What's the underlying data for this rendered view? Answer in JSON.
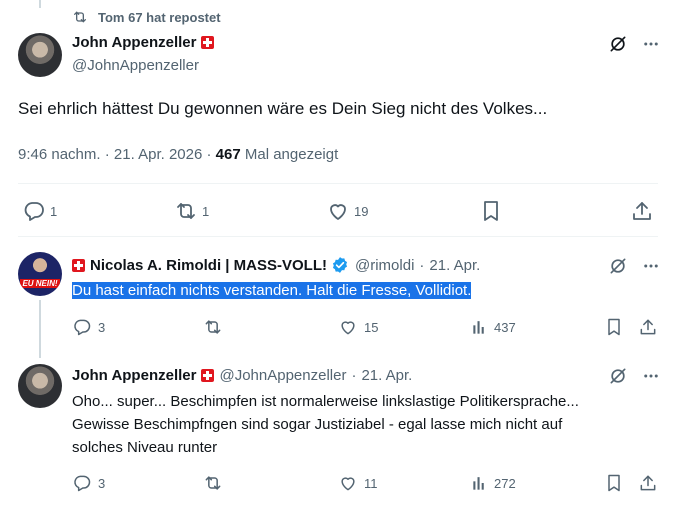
{
  "repost_header": {
    "text": "Tom 67 hat repostet"
  },
  "main_tweet": {
    "author_name": "John Appenzeller",
    "author_handle": "@JohnAppenzeller",
    "text": "Sei ehrlich hättest Du gewonnen wäre es Dein Sieg nicht des Volkes...",
    "time": "9:46 nachm.",
    "date": "21. Apr. 2026",
    "views_count": "467",
    "views_label": "Mal angezeigt",
    "replies": "1",
    "reposts": "1",
    "likes": "19"
  },
  "reply_1": {
    "author_name": "Nicolas A. Rimoldi | MASS-VOLL!",
    "author_handle": "@rimoldi",
    "date": "21. Apr.",
    "text": "Du hast einfach nichts verstanden. Halt die Fresse, Vollidiot.",
    "replies": "3",
    "likes": "15",
    "views": "437",
    "avatar_text": "EU NEIN!"
  },
  "reply_2": {
    "author_name": "John Appenzeller",
    "author_handle": "@JohnAppenzeller",
    "date": "21. Apr.",
    "text_lines": [
      "Oho... super... Beschimpfen ist normalerweise linkslastige Politikersprache...",
      "Gewisse Beschimpfngen sind sogar Justiziabel - egal lasse mich nicht auf",
      "solches Niveau runter"
    ],
    "replies": "3",
    "likes": "11",
    "views": "272"
  },
  "separator": "·",
  "colors": {
    "muted": "#536471",
    "selection": "#1a73e8",
    "verified": "#1d9bf0",
    "flag": "#e0171f"
  }
}
